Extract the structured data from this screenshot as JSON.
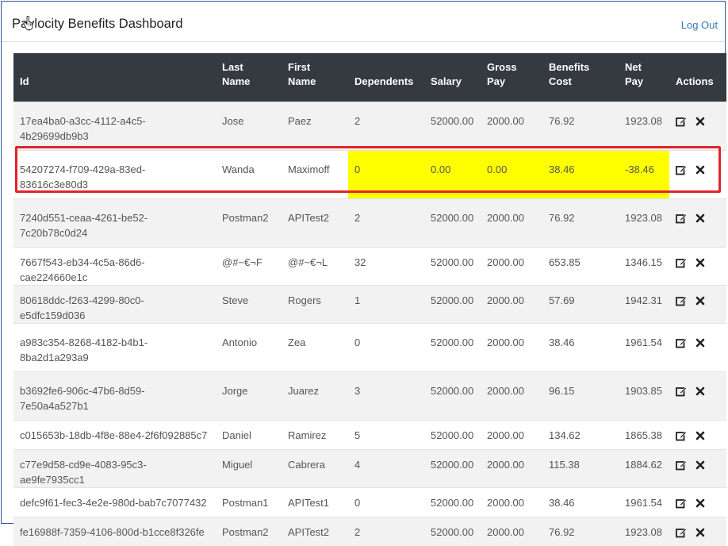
{
  "header": {
    "brand": "Paylocity Benefits Dashboard",
    "logout_label": "Log Out"
  },
  "table": {
    "columns": [
      {
        "key": "id",
        "label1": "",
        "label2": "Id"
      },
      {
        "key": "last",
        "label1": "Last",
        "label2": "Name"
      },
      {
        "key": "first",
        "label1": "First",
        "label2": "Name"
      },
      {
        "key": "dependents",
        "label1": "",
        "label2": "Dependents"
      },
      {
        "key": "salary",
        "label1": "",
        "label2": "Salary"
      },
      {
        "key": "gross",
        "label1": "Gross",
        "label2": "Pay"
      },
      {
        "key": "benefits",
        "label1": "Benefits",
        "label2": "Cost"
      },
      {
        "key": "net",
        "label1": "Net",
        "label2": "Pay"
      },
      {
        "key": "actions",
        "label1": "",
        "label2": "Actions"
      }
    ],
    "rows": [
      {
        "id": "17ea4ba0-a3cc-4112-a4c5-4b29699db9b3",
        "last": "Jose",
        "first": "Paez",
        "dependents": "2",
        "salary": "52000.00",
        "gross": "2000.00",
        "benefits": "76.92",
        "net": "1923.08"
      },
      {
        "id": "54207274-f709-429a-83ed-83616c3e80d3",
        "last": "Wanda",
        "first": "Maximoff",
        "dependents": "0",
        "salary": "0.00",
        "gross": "0.00",
        "benefits": "38.46",
        "net": "-38.46",
        "highlighted": true
      },
      {
        "id": "7240d551-ceaa-4261-be52-7c20b78c0d24",
        "last": "Postman2",
        "first": "APITest2",
        "dependents": "2",
        "salary": "52000.00",
        "gross": "2000.00",
        "benefits": "76.92",
        "net": "1923.08"
      },
      {
        "id": "7667f543-eb34-4c5a-86d6-cae224660e1c",
        "last": "@#~€¬F",
        "first": "@#~€¬L",
        "dependents": "32",
        "salary": "52000.00",
        "gross": "2000.00",
        "benefits": "653.85",
        "net": "1346.15"
      },
      {
        "id": "80618ddc-f263-4299-80c0-e5dfc159d036",
        "last": "Steve",
        "first": "Rogers",
        "dependents": "1",
        "salary": "52000.00",
        "gross": "2000.00",
        "benefits": "57.69",
        "net": "1942.31"
      },
      {
        "id": "a983c354-8268-4182-b4b1-8ba2d1a293a9",
        "last": "Antonio",
        "first": "Zea",
        "dependents": "0",
        "salary": "52000.00",
        "gross": "2000.00",
        "benefits": "38.46",
        "net": "1961.54"
      },
      {
        "id": "b3692fe6-906c-47b6-8d59-7e50a4a527b1",
        "last": "Jorge",
        "first": "Juarez",
        "dependents": "3",
        "salary": "52000.00",
        "gross": "2000.00",
        "benefits": "96.15",
        "net": "1903.85"
      },
      {
        "id": "c015653b-18db-4f8e-88e4-2f6f092885c7",
        "last": "Daniel",
        "first": "Ramirez",
        "dependents": "5",
        "salary": "52000.00",
        "gross": "2000.00",
        "benefits": "134.62",
        "net": "1865.38"
      },
      {
        "id": "c77e9d58-cd9e-4083-95c3-ae9fe7935cc1",
        "last": "Miguel",
        "first": "Cabrera",
        "dependents": "4",
        "salary": "52000.00",
        "gross": "2000.00",
        "benefits": "115.38",
        "net": "1884.62"
      },
      {
        "id": "defc9f61-fec3-4e2e-980d-bab7c7077432",
        "last": "Postman1",
        "first": "APITest1",
        "dependents": "0",
        "salary": "52000.00",
        "gross": "2000.00",
        "benefits": "38.46",
        "net": "1961.54"
      },
      {
        "id": "fe16988f-7359-4106-800d-b1cce8f326fe",
        "last": "Postman2",
        "first": "APITest2",
        "dependents": "2",
        "salary": "52000.00",
        "gross": "2000.00",
        "benefits": "76.92",
        "net": "1923.08"
      }
    ]
  },
  "icons": {
    "edit": "edit-icon",
    "delete": "delete-icon",
    "cursor": "hand-cursor-icon"
  },
  "colors": {
    "header_bg": "#343a40",
    "highlight": "#ffff00",
    "annotation_border": "#e0242b",
    "link": "#337ab7"
  }
}
